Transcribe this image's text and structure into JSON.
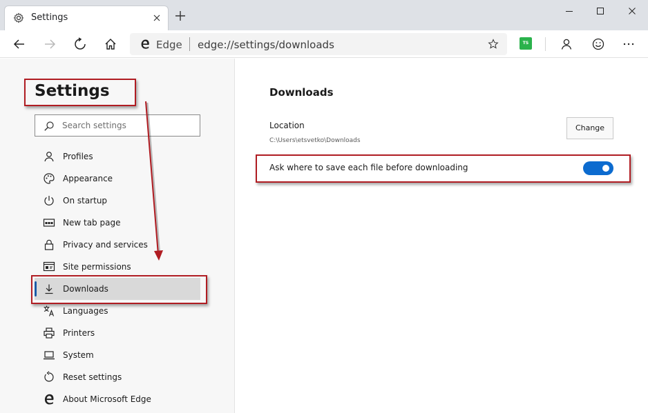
{
  "window": {
    "tab_title": "Settings"
  },
  "toolbar": {
    "brand": "Edge",
    "url": "edge://settings/downloads",
    "extension_badge": "TS"
  },
  "sidebar": {
    "title": "Settings",
    "search_placeholder": "Search settings",
    "items": [
      {
        "label": "Profiles",
        "icon": "person-icon"
      },
      {
        "label": "Appearance",
        "icon": "palette-icon"
      },
      {
        "label": "On startup",
        "icon": "power-icon"
      },
      {
        "label": "New tab page",
        "icon": "newtab-icon"
      },
      {
        "label": "Privacy and services",
        "icon": "lock-icon"
      },
      {
        "label": "Site permissions",
        "icon": "site-permissions-icon"
      },
      {
        "label": "Downloads",
        "icon": "download-icon",
        "active": true
      },
      {
        "label": "Languages",
        "icon": "languages-icon"
      },
      {
        "label": "Printers",
        "icon": "printer-icon"
      },
      {
        "label": "System",
        "icon": "laptop-icon"
      },
      {
        "label": "Reset settings",
        "icon": "reset-icon"
      },
      {
        "label": "About Microsoft Edge",
        "icon": "edge-logo-icon"
      }
    ]
  },
  "main": {
    "title": "Downloads",
    "location_label": "Location",
    "location_path": "C:\\Users\\etsvetko\\Downloads",
    "change_button": "Change",
    "ask_label": "Ask where to save each file before downloading",
    "ask_toggle_on": true
  },
  "colors": {
    "accent": "#0c6bcf",
    "highlight_border": "#b01c22",
    "active_indicator": "#1b5aa6"
  }
}
